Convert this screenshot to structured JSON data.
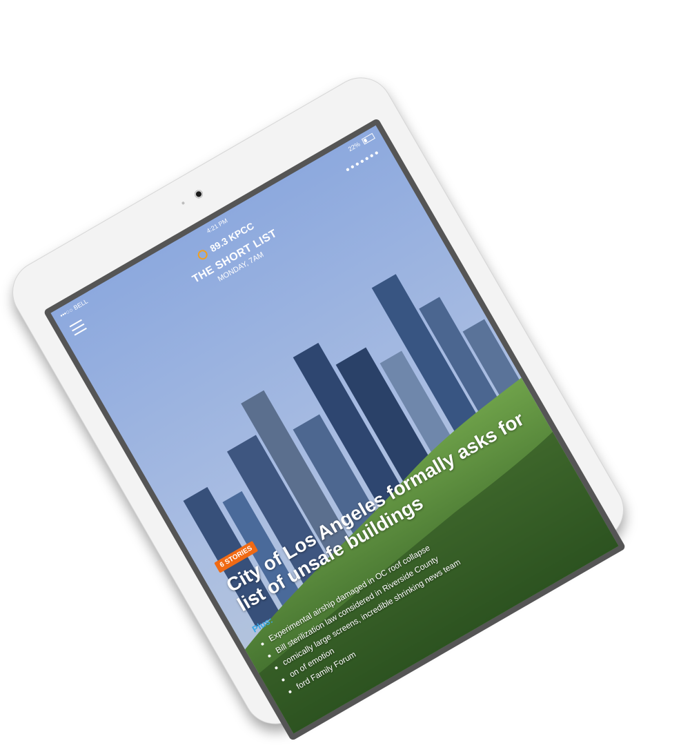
{
  "device": {
    "name": "tablet"
  },
  "status_bar": {
    "carrier": "•••○○ BELL",
    "time": "4:21 PM",
    "battery": "22%"
  },
  "header": {
    "logo_text": "89.3 KPCC",
    "title": "THE SHORT LIST",
    "subtitle": "MONDAY, 7AM"
  },
  "story": {
    "badge": "6 STORIES",
    "headline": "City of Los Angeles formally asks for list of unsafe buildings",
    "plus_label": "Plus:",
    "bullets": [
      "Experimental airship damaged in OC roof collapse",
      "Bill sterilization law considered in Riverside County",
      "comically large screens, incredible shrinking news team",
      "on of emotion",
      "ford Family Forum"
    ]
  },
  "colors": {
    "accent": "#f06a14",
    "plus": "#3aa7e6",
    "logo_ring": "#f0a020"
  }
}
